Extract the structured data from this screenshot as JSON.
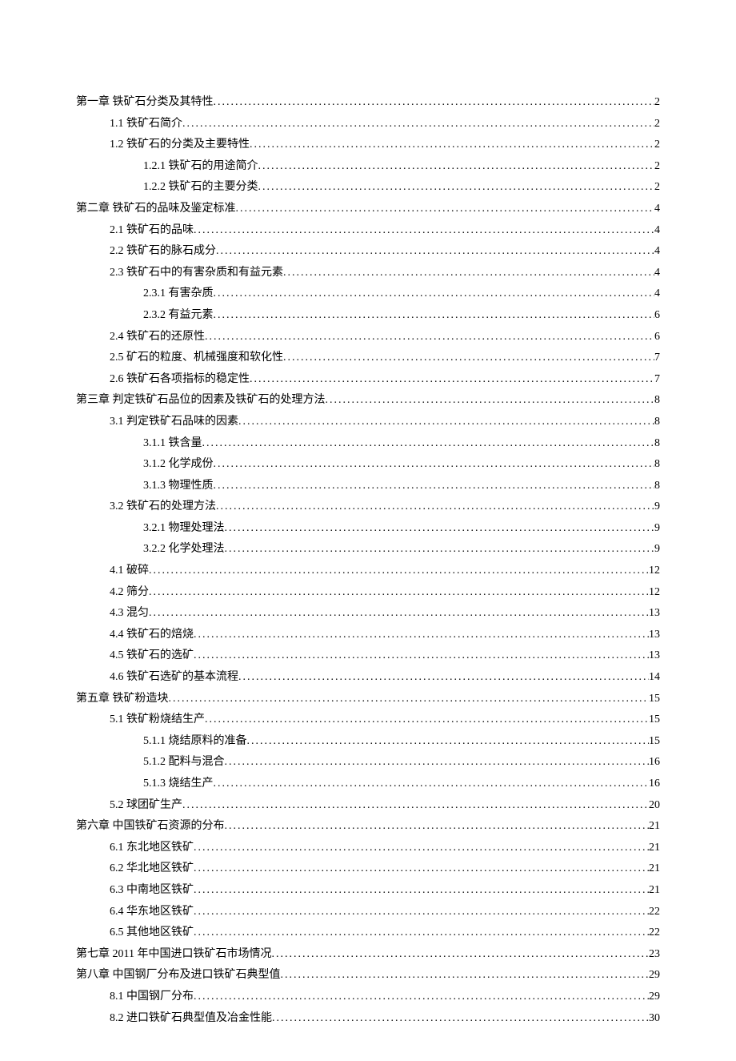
{
  "toc": [
    {
      "level": 0,
      "title": "第一章  铁矿石分类及其特性",
      "page": "2"
    },
    {
      "level": 1,
      "title": "1.1  铁矿石简介",
      "page": "2"
    },
    {
      "level": 1,
      "title": "1.2  铁矿石的分类及主要特性",
      "page": "2"
    },
    {
      "level": 2,
      "title": "1.2.1  铁矿石的用途简介",
      "page": "2"
    },
    {
      "level": 2,
      "title": "1.2.2  铁矿石的主要分类",
      "page": "2"
    },
    {
      "level": 0,
      "title": "第二章  铁矿石的品味及鉴定标准",
      "page": "4"
    },
    {
      "level": 1,
      "title": "2.1  铁矿石的品味",
      "page": "4"
    },
    {
      "level": 1,
      "title": "2.2  铁矿石的脉石成分",
      "page": "4"
    },
    {
      "level": 1,
      "title": "2.3  铁矿石中的有害杂质和有益元素",
      "page": "4"
    },
    {
      "level": 2,
      "title": "2.3.1  有害杂质",
      "page": "4"
    },
    {
      "level": 2,
      "title": "2.3.2  有益元素",
      "page": "6"
    },
    {
      "level": 1,
      "title": "2.4  铁矿石的还原性",
      "page": "6"
    },
    {
      "level": 1,
      "title": "2.5  矿石的粒度、机械强度和软化性",
      "page": "7"
    },
    {
      "level": 1,
      "title": "2.6  铁矿石各项指标的稳定性",
      "page": "7"
    },
    {
      "level": 0,
      "title": "第三章  判定铁矿石品位的因素及铁矿石的处理方法",
      "page": "8"
    },
    {
      "level": 1,
      "title": "3.1  判定铁矿石品味的因素",
      "page": "8"
    },
    {
      "level": 2,
      "title": "3.1.1  铁含量",
      "page": "8"
    },
    {
      "level": 2,
      "title": "3.1.2  化学成份",
      "page": "8"
    },
    {
      "level": 2,
      "title": "3.1.3  物理性质",
      "page": "8"
    },
    {
      "level": 1,
      "title": "3.2  铁矿石的处理方法",
      "page": "9"
    },
    {
      "level": 2,
      "title": "3.2.1  物理处理法",
      "page": "9"
    },
    {
      "level": 2,
      "title": "3.2.2  化学处理法",
      "page": "9"
    },
    {
      "level": 1,
      "title": "4.1  破碎",
      "page": "12"
    },
    {
      "level": 1,
      "title": "4.2  筛分",
      "page": "12"
    },
    {
      "level": 1,
      "title": "4.3  混匀",
      "page": "13"
    },
    {
      "level": 1,
      "title": "4.4  铁矿石的焙烧",
      "page": "13"
    },
    {
      "level": 1,
      "title": "4.5  铁矿石的选矿",
      "page": "13"
    },
    {
      "level": 1,
      "title": "4.6  铁矿石选矿的基本流程",
      "page": "14"
    },
    {
      "level": 0,
      "title": "第五章  铁矿粉造块",
      "page": "15"
    },
    {
      "level": 1,
      "title": "5.1  铁矿粉烧结生产",
      "page": "15"
    },
    {
      "level": 2,
      "title": "5.1.1  烧结原料的准备",
      "page": "15"
    },
    {
      "level": 2,
      "title": "5.1.2  配料与混合",
      "page": "16"
    },
    {
      "level": 2,
      "title": "5.1.3  烧结生产",
      "page": "16"
    },
    {
      "level": 1,
      "title": "5.2  球团矿生产",
      "page": "20"
    },
    {
      "level": 0,
      "title": "第六章  中国铁矿石资源的分布",
      "page": "21"
    },
    {
      "level": 1,
      "title": "6.1  东北地区铁矿",
      "page": "21"
    },
    {
      "level": 1,
      "title": "6.2  华北地区铁矿",
      "page": "21"
    },
    {
      "level": 1,
      "title": "6.3  中南地区铁矿",
      "page": "21"
    },
    {
      "level": 1,
      "title": "6.4  华东地区铁矿",
      "page": "22"
    },
    {
      "level": 1,
      "title": "6.5  其他地区铁矿",
      "page": "22"
    },
    {
      "level": 0,
      "title": "第七章  2011 年中国进口铁矿石市场情况",
      "page": "23"
    },
    {
      "level": 0,
      "title": "第八章  中国钢厂分布及进口铁矿石典型值",
      "page": "29"
    },
    {
      "level": 1,
      "title": "8.1  中国钢厂分布",
      "page": "29"
    },
    {
      "level": 1,
      "title": "8.2  进口铁矿石典型值及冶金性能",
      "page": "30"
    }
  ]
}
